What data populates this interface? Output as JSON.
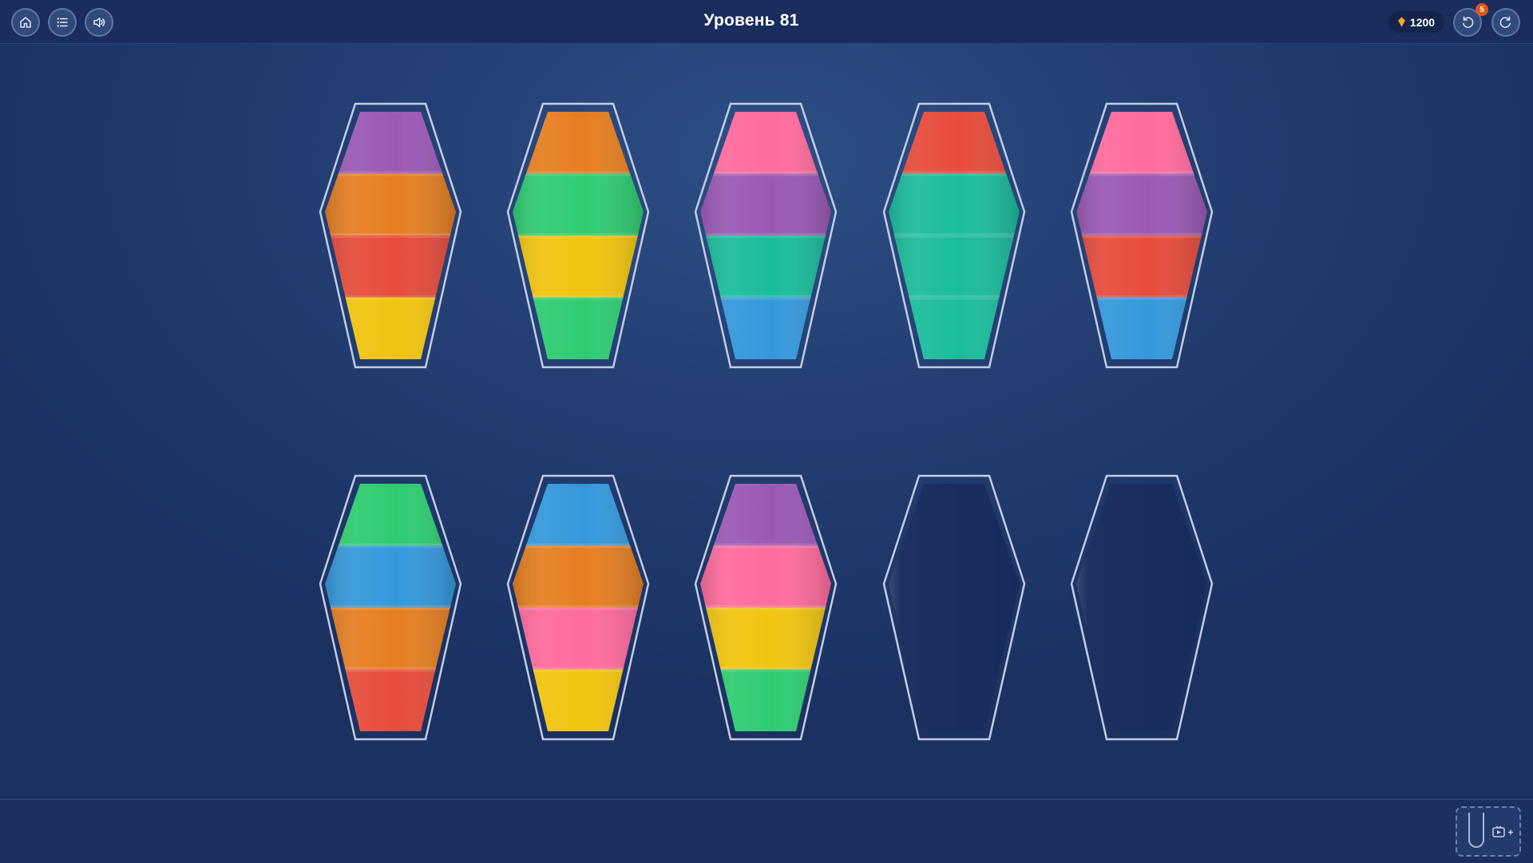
{
  "header": {
    "title": "Уровень 81",
    "coins": "1200",
    "undo_count": "5",
    "buttons": [
      "home-icon",
      "menu-list-icon",
      "sound-icon"
    ],
    "right_buttons": [
      "undo-icon",
      "restart-icon"
    ]
  },
  "colors": {
    "purple": "#9b59b6",
    "orange": "#e67e22",
    "red": "#e74c3c",
    "yellow": "#f1c40f",
    "green": "#2ecc71",
    "teal": "#1abc9c",
    "pink": "#ff6b9d",
    "blue": "#3498db"
  },
  "tubes": [
    {
      "layers": [
        "purple",
        "orange",
        "red",
        "yellow"
      ]
    },
    {
      "layers": [
        "orange",
        "green",
        "yellow",
        "green"
      ]
    },
    {
      "layers": [
        "pink",
        "purple",
        "teal",
        "blue"
      ]
    },
    {
      "layers": [
        "red",
        "teal",
        "teal",
        "teal"
      ]
    },
    {
      "layers": [
        "pink",
        "purple",
        "red",
        "blue"
      ]
    },
    {
      "layers": [
        "green",
        "blue",
        "orange",
        "red"
      ]
    },
    {
      "layers": [
        "blue",
        "orange",
        "pink",
        "yellow"
      ]
    },
    {
      "layers": [
        "purple",
        "pink",
        "yellow",
        "green"
      ]
    },
    {
      "layers": []
    },
    {
      "layers": []
    }
  ],
  "footer": {
    "add_tube_icons": [
      "tube-icon",
      "video-ad-icon"
    ]
  }
}
